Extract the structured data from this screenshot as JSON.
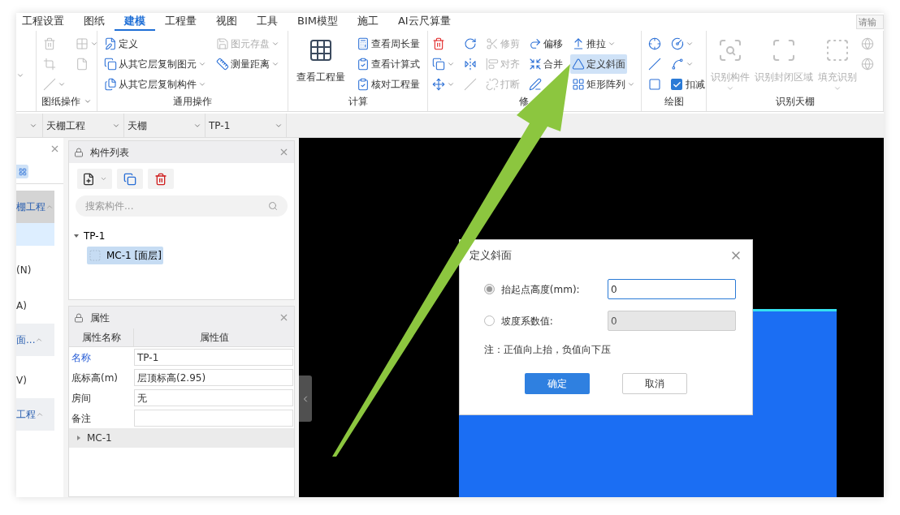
{
  "menu_tabs": [
    {
      "label": "工程设置",
      "selected": false
    },
    {
      "label": "图纸",
      "selected": false
    },
    {
      "label": "建模",
      "selected": true
    },
    {
      "label": "工程量",
      "selected": false
    },
    {
      "label": "视图",
      "selected": false
    },
    {
      "label": "工具",
      "selected": false
    },
    {
      "label": "BIM模型",
      "selected": false
    },
    {
      "label": "施工",
      "selected": false
    },
    {
      "label": "AI云尺算量",
      "selected": false
    }
  ],
  "search": {
    "placeholder": "请输"
  },
  "ribbon": [
    {
      "label": "图纸操作",
      "has_menu": true,
      "columns": [
        [
          {
            "kind": "small",
            "disabled": true,
            "dropdown": false,
            "selected": false
          },
          {
            "kind": "small",
            "disabled": true,
            "dropdown": false,
            "selected": false
          },
          {
            "kind": "small",
            "disabled": true,
            "dropdown": true,
            "selected": false
          }
        ],
        [
          {
            "kind": "small",
            "disabled": true,
            "dropdown": true,
            "selected": false
          },
          {
            "kind": "small",
            "disabled": true,
            "dropdown": false,
            "selected": false
          }
        ]
      ]
    },
    {
      "label": "通用操作",
      "has_menu": false,
      "columns": [
        [
          {
            "kind": "small",
            "label": "定义",
            "disabled": false,
            "dropdown": false,
            "selected": false
          },
          {
            "kind": "small",
            "label": "从其它层复制图元",
            "disabled": false,
            "dropdown": true,
            "selected": false
          },
          {
            "kind": "small",
            "label": "从其它层复制构件",
            "disabled": false,
            "dropdown": true,
            "selected": false
          }
        ],
        [
          {
            "kind": "small",
            "label": "图元存盘",
            "disabled": true,
            "dropdown": true,
            "selected": false
          },
          {
            "kind": "small",
            "label": "测量距离",
            "disabled": false,
            "dropdown": true,
            "selected": false
          }
        ]
      ]
    },
    {
      "label": "计算",
      "has_menu": false,
      "columns": [
        [
          {
            "kind": "large",
            "label": "查看工程量",
            "disabled": false,
            "dropdown": false,
            "selected": false
          }
        ],
        [
          {
            "kind": "small",
            "label": "查看周长量",
            "disabled": false,
            "dropdown": false,
            "selected": false
          },
          {
            "kind": "small",
            "label": "查看计算式",
            "disabled": false,
            "dropdown": false,
            "selected": false
          },
          {
            "kind": "small",
            "label": "核对工程量",
            "disabled": false,
            "dropdown": false,
            "selected": false
          }
        ]
      ]
    },
    {
      "label": "修",
      "has_menu": false,
      "columns": [
        [
          {
            "kind": "small",
            "disabled": false,
            "dropdown": false,
            "selected": false
          },
          {
            "kind": "small",
            "disabled": false,
            "dropdown": true,
            "selected": false
          },
          {
            "kind": "small",
            "disabled": false,
            "dropdown": true,
            "selected": false
          }
        ],
        [
          {
            "kind": "small",
            "disabled": false,
            "dropdown": false,
            "selected": false
          },
          {
            "kind": "small",
            "disabled": false,
            "dropdown": false,
            "selected": false
          },
          {
            "kind": "small",
            "disabled": true,
            "dropdown": false,
            "selected": false
          }
        ],
        [
          {
            "kind": "small",
            "label": "修剪",
            "disabled": true,
            "dropdown": false,
            "selected": false
          },
          {
            "kind": "small",
            "label": "对齐",
            "disabled": true,
            "dropdown": false,
            "selected": false
          },
          {
            "kind": "small",
            "label": "打断",
            "disabled": true,
            "dropdown": false,
            "selected": false
          }
        ],
        [
          {
            "kind": "small",
            "label": "偏移",
            "disabled": false,
            "dropdown": false,
            "selected": false
          },
          {
            "kind": "small",
            "label": "合并",
            "disabled": false,
            "dropdown": false,
            "selected": false
          },
          {
            "kind": "small",
            "disabled": false,
            "dropdown": false,
            "selected": false
          }
        ],
        [
          {
            "kind": "small",
            "label": "推拉",
            "disabled": false,
            "dropdown": true,
            "selected": false
          },
          {
            "kind": "small",
            "label": "定义斜面",
            "disabled": false,
            "dropdown": false,
            "selected": true
          },
          {
            "kind": "small",
            "label": "矩形阵列",
            "disabled": false,
            "dropdown": true,
            "selected": false
          }
        ]
      ]
    },
    {
      "label": "绘图",
      "has_menu": false,
      "columns": [
        [
          {
            "kind": "small",
            "disabled": false,
            "dropdown": false,
            "selected": false
          },
          {
            "kind": "small",
            "disabled": false,
            "dropdown": false,
            "selected": false
          },
          {
            "kind": "small",
            "disabled": false,
            "dropdown": false,
            "selected": false
          }
        ],
        [
          {
            "kind": "small",
            "disabled": false,
            "dropdown": true,
            "selected": false
          },
          {
            "kind": "small",
            "disabled": false,
            "dropdown": true,
            "selected": false
          },
          {
            "kind": "checkbox",
            "label": "扣减",
            "checked": true,
            "disabled": false,
            "dropdown": false,
            "selected": false
          }
        ]
      ]
    },
    {
      "label": "识别天棚",
      "has_menu": false,
      "columns": [
        [
          {
            "kind": "large",
            "label": "识别构件",
            "disabled": true,
            "dropdown": true,
            "selected": false
          }
        ],
        [
          {
            "kind": "large",
            "label": "识别封闭区域",
            "disabled": true,
            "dropdown": false,
            "selected": false
          }
        ],
        [
          {
            "kind": "large",
            "label": "填充识别",
            "disabled": true,
            "dropdown": true,
            "selected": false
          }
        ],
        [
          {
            "kind": "small",
            "disabled": true,
            "dropdown": false,
            "selected": false
          },
          {
            "kind": "small",
            "disabled": true,
            "dropdown": false,
            "selected": false
          }
        ]
      ]
    }
  ],
  "selectors": [
    {
      "value": "天棚工程"
    },
    {
      "value": "天棚"
    },
    {
      "value": "TP-1"
    }
  ],
  "left_panel": {
    "items": [
      {
        "kind": "header",
        "label": "棚工程",
        "selected": false
      },
      {
        "kind": "item",
        "selected": true
      },
      {
        "kind": "item",
        "label": "(N)",
        "selected": false
      },
      {
        "kind": "item",
        "label": "A)",
        "selected": false
      },
      {
        "kind": "header",
        "label": "面...",
        "selected": false
      },
      {
        "kind": "item",
        "label": "V)",
        "selected": false
      },
      {
        "kind": "header",
        "label": "工程",
        "selected": false
      }
    ]
  },
  "component_list": {
    "title": "构件列表",
    "search": {
      "placeholder": "搜索构件..."
    },
    "tree": [
      {
        "label": "TP-1",
        "expanded": true,
        "selected": false,
        "children": [
          {
            "label": "MC-1 [面层]",
            "selected": true
          }
        ]
      }
    ]
  },
  "properties": {
    "title": "属性",
    "columns": [
      "属性名称",
      "属性值"
    ],
    "rows": [
      {
        "name": "名称",
        "value": "TP-1",
        "shared": true
      },
      {
        "name": "底标高(m)",
        "value": "层顶标高(2.95)",
        "shared": false
      },
      {
        "name": "房间",
        "value": "无",
        "shared": false
      },
      {
        "name": "备注",
        "shared": false
      }
    ],
    "groups": [
      {
        "label": "MC-1",
        "expanded": false
      }
    ]
  },
  "dialog": {
    "title": "定义斜面",
    "options": [
      {
        "label": "抬起点高度(mm):",
        "value": "0",
        "selected": true
      },
      {
        "label": "坡度系数值:",
        "value": "0",
        "selected": false
      }
    ],
    "note": "注：正值向上抬，负值向下压",
    "buttons": [
      {
        "label": "确定",
        "primary": true
      },
      {
        "label": "取消",
        "primary": false
      }
    ]
  }
}
